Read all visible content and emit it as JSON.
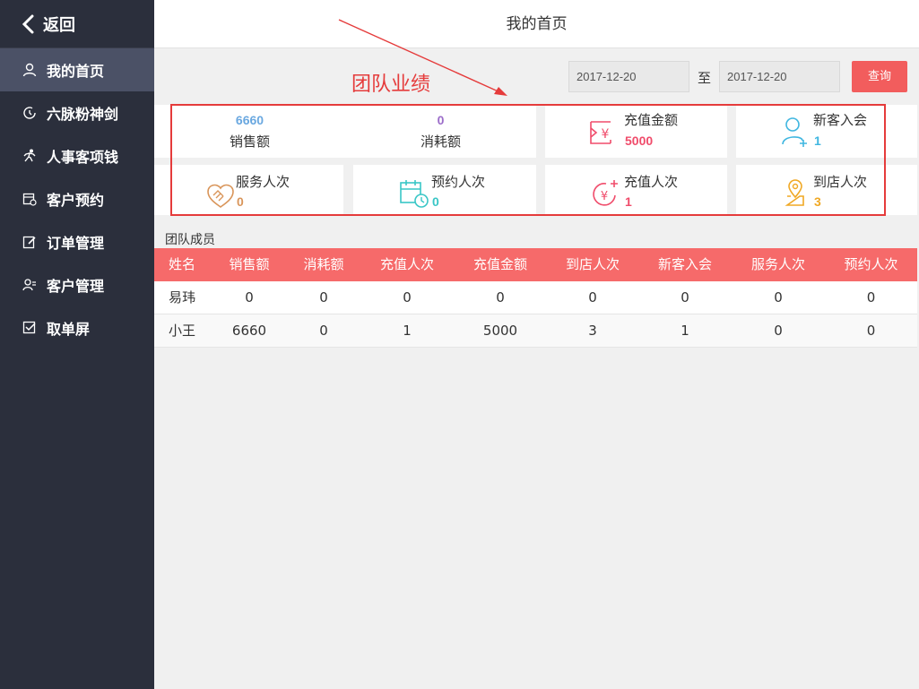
{
  "sidebar": {
    "back_label": "返回",
    "items": [
      {
        "label": "我的首页",
        "icon": "user-icon",
        "active": true
      },
      {
        "label": "六脉粉神剑",
        "icon": "clock-icon",
        "active": false
      },
      {
        "label": "人事客项钱",
        "icon": "person-run-icon",
        "active": false
      },
      {
        "label": "客户预约",
        "icon": "calendar-icon",
        "active": false
      },
      {
        "label": "订单管理",
        "icon": "edit-icon",
        "active": false
      },
      {
        "label": "客户管理",
        "icon": "users-icon",
        "active": false
      },
      {
        "label": "取单屏",
        "icon": "checkbox-icon",
        "active": false
      }
    ]
  },
  "header": {
    "title": "我的首页"
  },
  "filter": {
    "start_date": "2017-12-20",
    "to_label": "至",
    "end_date": "2017-12-20",
    "query_label": "查询"
  },
  "annotation": {
    "text": "团队业绩"
  },
  "stats": {
    "sales": {
      "value": "6660",
      "label": "销售额"
    },
    "consume": {
      "value": "0",
      "label": "消耗额"
    },
    "recharge_amount": {
      "label": "充值金额",
      "value": "5000"
    },
    "new_members": {
      "label": "新客入会",
      "value": "1"
    },
    "service_count": {
      "label": "服务人次",
      "value": "0"
    },
    "appointment_count": {
      "label": "预约人次",
      "value": "0"
    },
    "recharge_count": {
      "label": "充值人次",
      "value": "1"
    },
    "visit_count": {
      "label": "到店人次",
      "value": "3"
    }
  },
  "colors": {
    "sales": "#6aa8e0",
    "consume": "#9b6cc9",
    "recharge_amount": "#f04c6b",
    "new_members": "#3fb6e0",
    "service": "#d9955a",
    "appointment": "#39c6c6",
    "recharge_count": "#f04c6b",
    "visit": "#f0a824"
  },
  "team": {
    "title": "团队成员",
    "headers": [
      "姓名",
      "销售额",
      "消耗额",
      "充值人次",
      "充值金额",
      "到店人次",
      "新客入会",
      "服务人次",
      "预约人次"
    ],
    "rows": [
      [
        "易玮",
        "0",
        "0",
        "0",
        "0",
        "0",
        "0",
        "0",
        "0"
      ],
      [
        "小王",
        "6660",
        "0",
        "1",
        "5000",
        "3",
        "1",
        "0",
        "0"
      ]
    ]
  }
}
